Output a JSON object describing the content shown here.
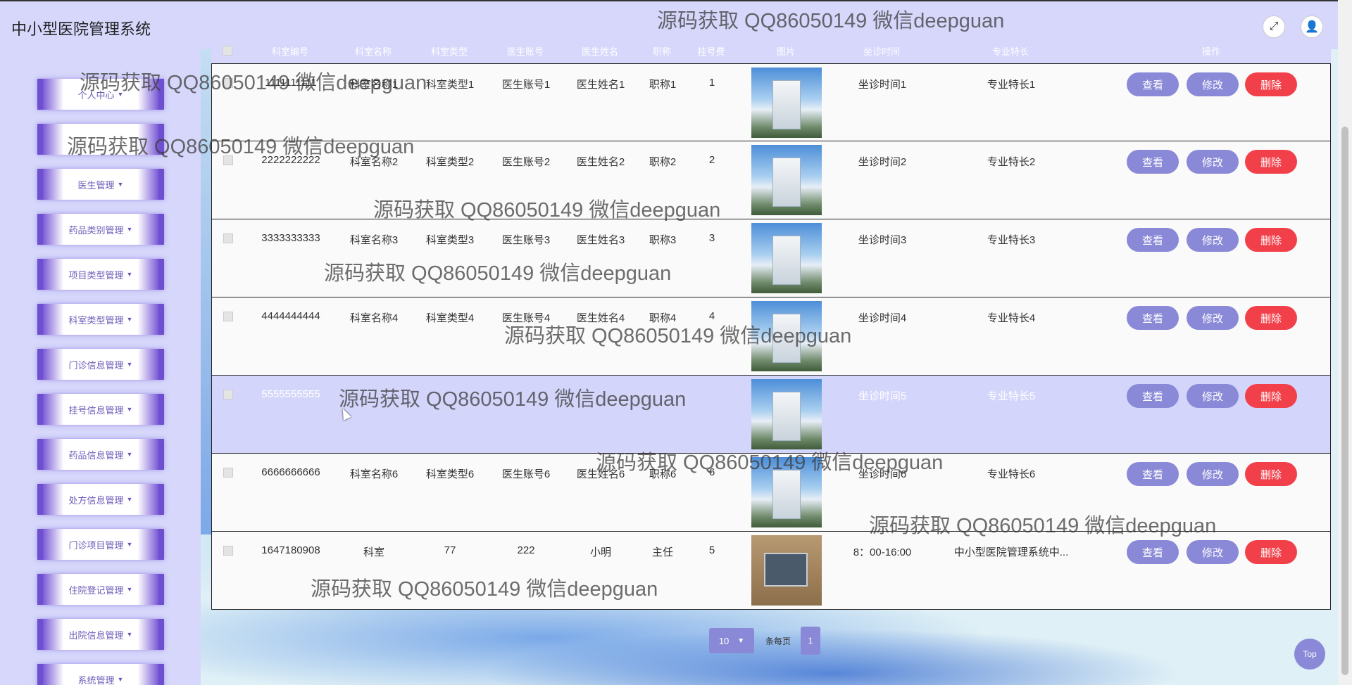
{
  "app": {
    "title": "中小型医院管理系统"
  },
  "header": {
    "fullscreen_icon": "fullscreen-icon",
    "user_icon": "user-icon"
  },
  "sidebar": {
    "items": [
      {
        "label": "个人中心"
      },
      {
        "label": ""
      },
      {
        "label": "医生管理"
      },
      {
        "label": "药品类别管理"
      },
      {
        "label": "项目类型管理"
      },
      {
        "label": "科室类型管理"
      },
      {
        "label": "门诊信息管理"
      },
      {
        "label": "挂号信息管理"
      },
      {
        "label": "药品信息管理"
      },
      {
        "label": "处方信息管理"
      },
      {
        "label": "门诊项目管理"
      },
      {
        "label": "住院登记管理"
      },
      {
        "label": "出院信息管理"
      },
      {
        "label": "系统管理"
      }
    ]
  },
  "table": {
    "headers": [
      "科室编号",
      "科室名称",
      "科室类型",
      "医生账号",
      "医生姓名",
      "职称",
      "挂号费",
      "图片",
      "坐诊时间",
      "专业特长",
      "操作"
    ],
    "rows": [
      {
        "code": "1111111111",
        "dept": "科室名称1",
        "type": "科室类型1",
        "account": "医生账号1",
        "name": "医生姓名1",
        "title": "职称1",
        "fee": "1",
        "time": "坐诊时间1",
        "spec": "专业特长1"
      },
      {
        "code": "2222222222",
        "dept": "科室名称2",
        "type": "科室类型2",
        "account": "医生账号2",
        "name": "医生姓名2",
        "title": "职称2",
        "fee": "2",
        "time": "坐诊时间2",
        "spec": "专业特长2"
      },
      {
        "code": "3333333333",
        "dept": "科室名称3",
        "type": "科室类型3",
        "account": "医生账号3",
        "name": "医生姓名3",
        "title": "职称3",
        "fee": "3",
        "time": "坐诊时间3",
        "spec": "专业特长3"
      },
      {
        "code": "4444444444",
        "dept": "科室名称4",
        "type": "科室类型4",
        "account": "医生账号4",
        "name": "医生姓名4",
        "title": "职称4",
        "fee": "4",
        "time": "坐诊时间4",
        "spec": "专业特长4"
      },
      {
        "code": "5555555555",
        "dept": "",
        "type": "",
        "account": "",
        "name": "",
        "title": "",
        "fee": "",
        "time": "坐诊时间5",
        "spec": "专业特长5"
      },
      {
        "code": "6666666666",
        "dept": "科室名称6",
        "type": "科室类型6",
        "account": "医生账号6",
        "name": "医生姓名6",
        "title": "职称6",
        "fee": "6",
        "time": "坐诊时间6",
        "spec": "专业特长6"
      },
      {
        "code": "1647180908",
        "dept": "科室",
        "type": "77",
        "account": "222",
        "name": "小明",
        "title": "主任",
        "fee": "5",
        "time": "8：00-16:00",
        "spec": "中小型医院管理系统中..."
      }
    ],
    "actions": {
      "view": "查看",
      "edit": "修改",
      "delete": "删除"
    }
  },
  "pagination": {
    "page_size": "10",
    "per_page_label": "条每页",
    "current_page": "1"
  },
  "top_button": "Top",
  "watermark": "源码获取 QQ86050149 微信deepguan"
}
